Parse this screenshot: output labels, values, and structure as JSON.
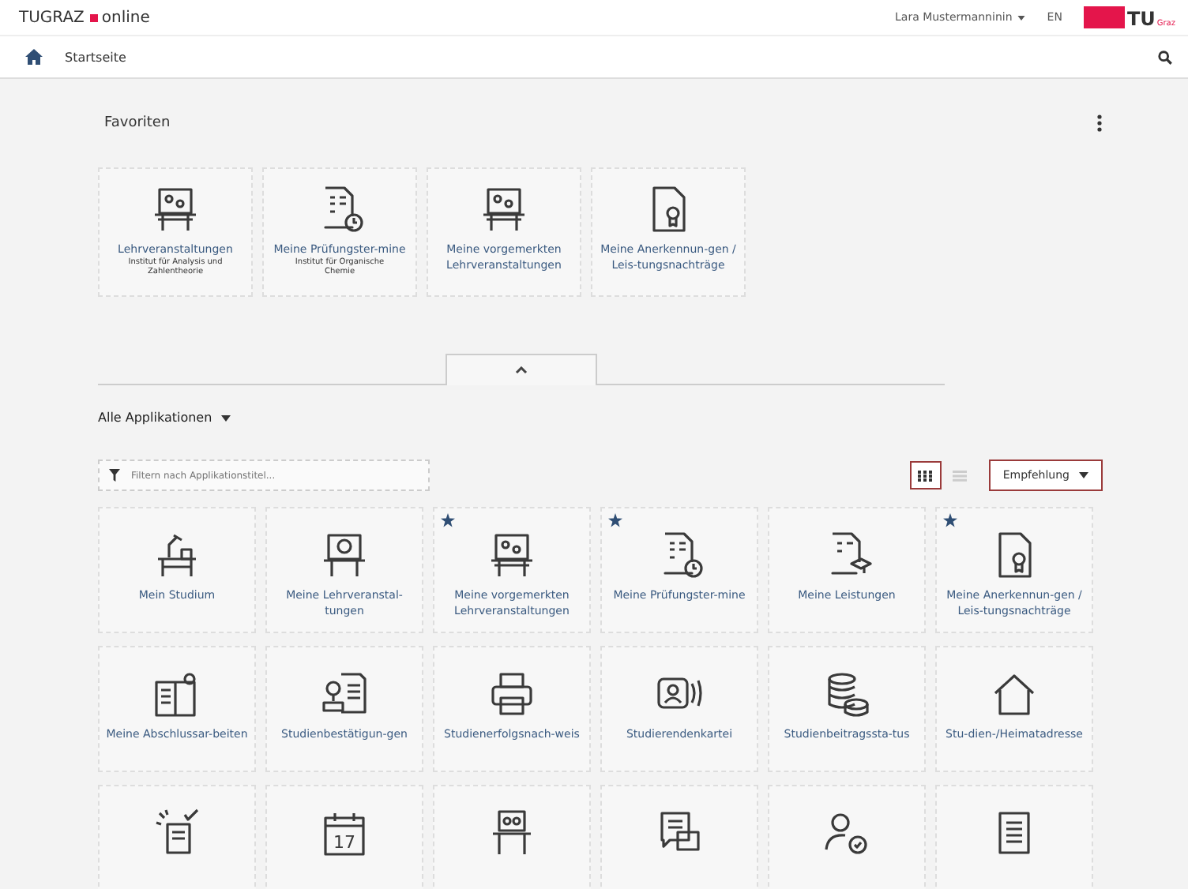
{
  "header": {
    "brand": "TUGRAZ",
    "brand_suffix": "online",
    "user": "Lara Mustermanninin",
    "language": "EN",
    "logo": "TU",
    "logo_sub": "Graz"
  },
  "nav": {
    "breadcrumb": "Startseite"
  },
  "favorites": {
    "title": "Favoriten",
    "tiles": [
      {
        "label": "Lehrveranstaltungen",
        "subtitle": "Institut für Analysis und Zahlentheorie"
      },
      {
        "label": "Meine Prüfungster-mine",
        "subtitle": "Institut für Organische Chemie"
      },
      {
        "label": "Meine vorgemerkten Lehrveranstaltungen"
      },
      {
        "label": "Meine Anerkennun-gen / Leis-tungsnachträge"
      }
    ]
  },
  "applications": {
    "title": "Alle Applikationen",
    "filter_placeholder": "Filtern nach Applikationstitel...",
    "views": [
      {
        "selected": true
      },
      {
        "selected": false
      }
    ],
    "sort": "Empfehlung",
    "tiles": [
      {
        "label": "Mein Studium",
        "starred": false
      },
      {
        "label": "Meine Lehrveranstal-tungen",
        "starred": false
      },
      {
        "label": "Meine vorgemerkten Lehrveranstaltungen",
        "starred": true
      },
      {
        "label": "Meine Prüfungster-mine",
        "starred": true
      },
      {
        "label": "Meine Leistungen",
        "starred": false
      },
      {
        "label": "Meine Anerkennun-gen / Leis-tungsnachträge",
        "starred": true
      },
      {
        "label": "Meine Abschlussar-beiten",
        "starred": false
      },
      {
        "label": "Studienbestätigun-gen",
        "starred": false
      },
      {
        "label": "Studienerfolgsnach-weis",
        "starred": false
      },
      {
        "label": "Studierendenkartei",
        "starred": false
      },
      {
        "label": "Studienbeitragssta-tus",
        "starred": false
      },
      {
        "label": "Stu-dien-/Heimatadresse",
        "starred": false
      },
      {
        "starred": false
      },
      {
        "starred": false,
        "icon_text": "17"
      },
      {
        "starred": false
      },
      {
        "starred": false
      },
      {
        "starred": false
      },
      {
        "starred": false
      }
    ]
  }
}
